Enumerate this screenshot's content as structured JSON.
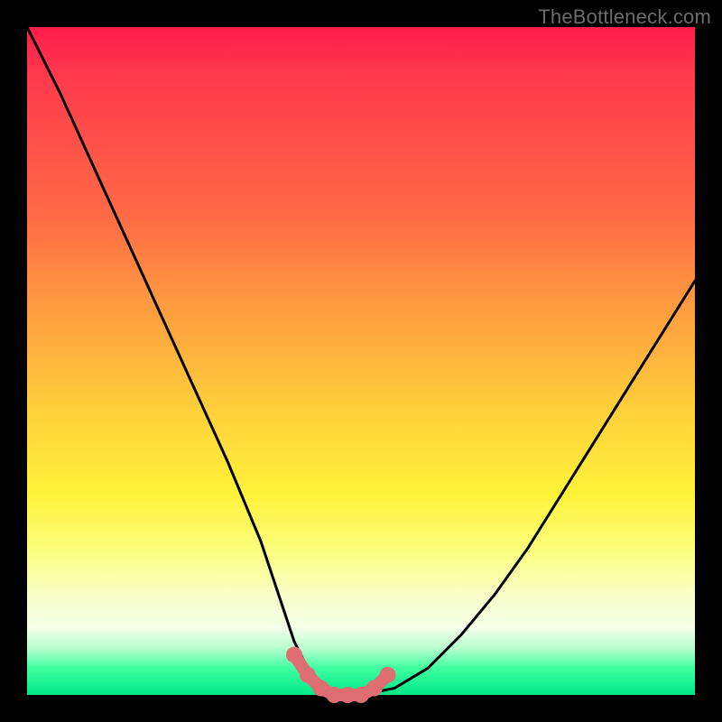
{
  "watermark": "TheBottleneck.com",
  "colors": {
    "frame": "#000000",
    "curve": "#000000",
    "marker": "#df6e72",
    "gradient_top": "#ff1d4a",
    "gradient_bottom": "#00e887"
  },
  "chart_data": {
    "type": "line",
    "title": "",
    "xlabel": "",
    "ylabel": "",
    "xlim": [
      0,
      100
    ],
    "ylim": [
      0,
      100
    ],
    "series": [
      {
        "name": "bottleneck-curve",
        "x": [
          0,
          5,
          10,
          15,
          20,
          25,
          30,
          35,
          38,
          40,
          42,
          45,
          48,
          50,
          55,
          60,
          65,
          70,
          75,
          80,
          85,
          90,
          95,
          100
        ],
        "values": [
          100,
          90,
          79,
          68,
          57,
          46,
          35,
          23,
          14,
          8,
          4,
          1,
          0,
          0,
          1,
          4,
          9,
          15,
          22,
          30,
          38,
          46,
          54,
          62
        ]
      }
    ],
    "markers": {
      "name": "optimal-range",
      "x": [
        40,
        42,
        44,
        46,
        48,
        50,
        52,
        54
      ],
      "values": [
        6,
        3,
        1,
        0,
        0,
        0,
        1,
        3
      ]
    },
    "grid": false,
    "legend": false
  }
}
